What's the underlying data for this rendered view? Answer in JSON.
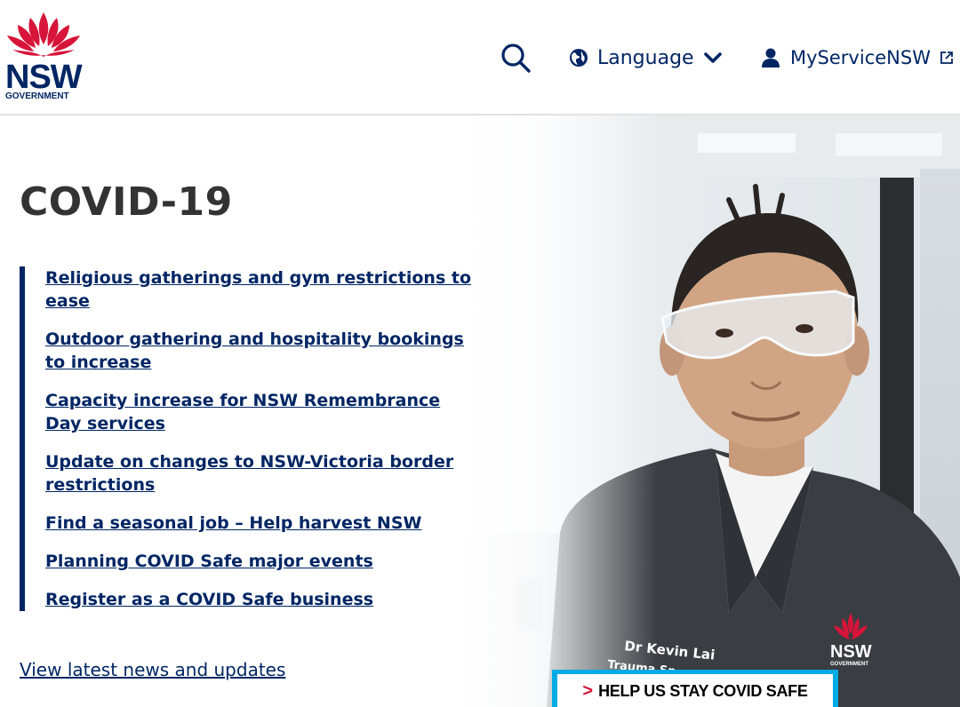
{
  "header": {
    "logo": {
      "wordmark": "NSW",
      "subtitle": "GOVERNMENT"
    },
    "nav": {
      "search_icon": "search-icon",
      "language_label": "Language",
      "myservice_label": "MyServiceNSW"
    }
  },
  "hero": {
    "title": "COVID-19",
    "links": [
      "Religious gatherings and gym restrictions to ease",
      "Outdoor gathering and hospitality bookings to increase",
      "Capacity increase for NSW Remembrance Day services",
      "Update on changes to NSW-Victoria border restrictions",
      "Find a seasonal job – Help harvest NSW",
      "Planning COVID Safe major events",
      "Register as a COVID Safe business"
    ],
    "view_all_label": "View latest news and updates",
    "photo": {
      "badge_line1": "Dr Kevin Lai",
      "badge_line2": "Trauma Sp",
      "shirt_logo_text": "NSW",
      "shirt_logo_sub": "GOVERNMENT"
    },
    "banner": {
      "arrow": ">",
      "text": "HELP US STAY COVID SAFE"
    }
  },
  "colors": {
    "brand_navy": "#002664",
    "brand_red": "#d7153a",
    "banner_blue": "#00abe6",
    "text_dark": "#333333"
  }
}
